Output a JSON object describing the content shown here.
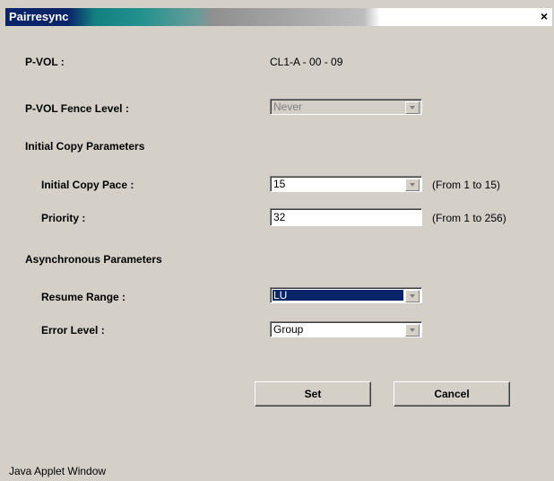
{
  "window": {
    "title": "Pairresync",
    "close_label": "×",
    "footer": "Java Applet Window"
  },
  "pvol": {
    "label": "P-VOL :",
    "value": "CL1-A - 00 - 09"
  },
  "fence": {
    "label": "P-VOL Fence Level :",
    "value": "Never"
  },
  "initial_copy": {
    "header": "Initial Copy Parameters",
    "pace_label": "Initial Copy Pace :",
    "pace_value": "15",
    "pace_hint": "(From 1 to 15)",
    "priority_label": "Priority :",
    "priority_value": "32",
    "priority_hint": "(From 1 to 256)"
  },
  "async": {
    "header": "Asynchronous Parameters",
    "resume_label": "Resume Range :",
    "resume_value": "LU",
    "error_label": "Error Level :",
    "error_value": "Group"
  },
  "buttons": {
    "set": "Set",
    "cancel": "Cancel"
  }
}
